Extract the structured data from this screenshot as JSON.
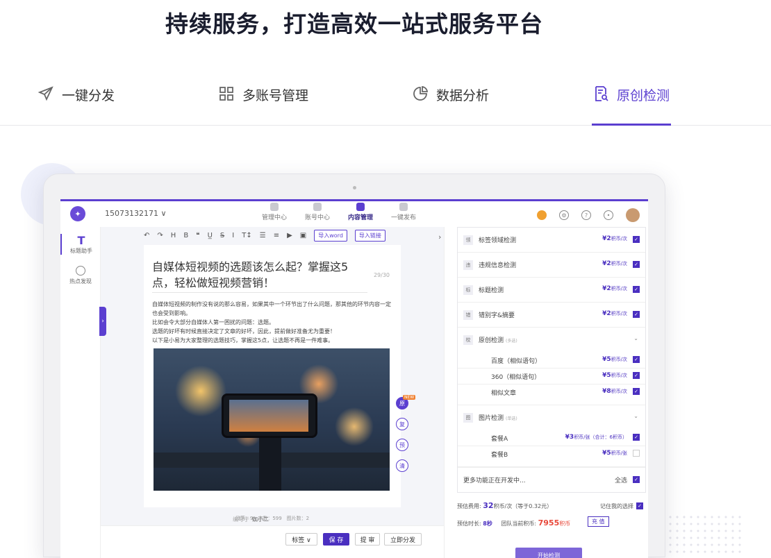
{
  "headline": "持续服务，打造高效一站式服务平台",
  "tabs": [
    {
      "label": "一键分发",
      "icon": "send-icon"
    },
    {
      "label": "多账号管理",
      "icon": "grid-icon"
    },
    {
      "label": "数据分析",
      "icon": "pie-chart-icon"
    },
    {
      "label": "原创检测",
      "icon": "document-search-icon",
      "active": true
    }
  ],
  "app": {
    "phone": "15073132171 ∨",
    "nav": [
      "管理中心",
      "账号中心",
      "内容管理",
      "一键发布"
    ],
    "active_nav": "内容管理",
    "left": [
      {
        "label": "标题助手",
        "glyph": "T"
      },
      {
        "label": "热点发现"
      }
    ],
    "toolbar": {
      "import_word": "导入word",
      "import_link": "导入链接"
    },
    "article": {
      "title": "自媒体短视频的选题该怎么起？掌握这5点，轻松做短视频营销！",
      "count": "29/30",
      "body": [
        "自媒体短视频的制作没有说的那么容易，如果其中一个环节出了什么问题，那其他的环节内容一定也会受到影响。",
        "比如会令大部分自媒体人第一困扰的问题：选题。",
        "选题的好坏有时候直接决定了文章的好坏，因此，提前做好准备尤为重要！",
        "以下是小易为大家整理的选题技巧，掌握这5点，让选题不再是一件难事。"
      ],
      "stats": "段落：9　字数：599　图片数：2",
      "author_label": "编写于",
      "author": "蜘小二"
    },
    "side_tools": [
      "原",
      "复",
      "预",
      "清"
    ],
    "new_tag": "NEW",
    "bottom": {
      "tag": "标签 ∨",
      "save": "保 存",
      "review": "提 审",
      "publish": "立即分发"
    },
    "checks": [
      {
        "icon": "领",
        "name": "标签领域检测",
        "price": "¥2",
        "unit": "积币/次"
      },
      {
        "icon": "违",
        "name": "违规信息检测",
        "price": "¥2",
        "unit": "积币/次"
      },
      {
        "icon": "标",
        "name": "标题检测",
        "price": "¥2",
        "unit": "积币/次"
      },
      {
        "icon": "错",
        "name": "错别字&摘要",
        "price": "¥2",
        "unit": "积币/次"
      }
    ],
    "original": {
      "icon": "校",
      "name": "原创检测",
      "note": "(多选)",
      "items": [
        {
          "name": "百度（相似语句）",
          "price": "¥5",
          "unit": "积币/次"
        },
        {
          "name": "360（相似语句）",
          "price": "¥5",
          "unit": "积币/次"
        },
        {
          "name": "相似文章",
          "price": "¥8",
          "unit": "积币/次"
        }
      ]
    },
    "image": {
      "icon": "图",
      "name": "图片检测",
      "note": "(单选)",
      "items": [
        {
          "name": "套餐A",
          "price": "¥3",
          "unit": "积币/张（合计：6积币）",
          "checked": true
        },
        {
          "name": "套餐B",
          "price": "¥5",
          "unit": "积币/张",
          "checked": false
        }
      ]
    },
    "more": "更多功能正在开发中...",
    "select_all": "全选",
    "estimate_cost_label": "预估费用:",
    "estimate_cost": "32",
    "estimate_cost_unit": "积币/次（等于0.32元）",
    "remember": "记住我的选择",
    "estimate_time_label": "预估时长:",
    "estimate_time": "8秒",
    "balance_label": "团队当前积币:",
    "balance": "7955",
    "balance_unit": "积币",
    "recharge": "充 值",
    "start": "开始检测"
  }
}
